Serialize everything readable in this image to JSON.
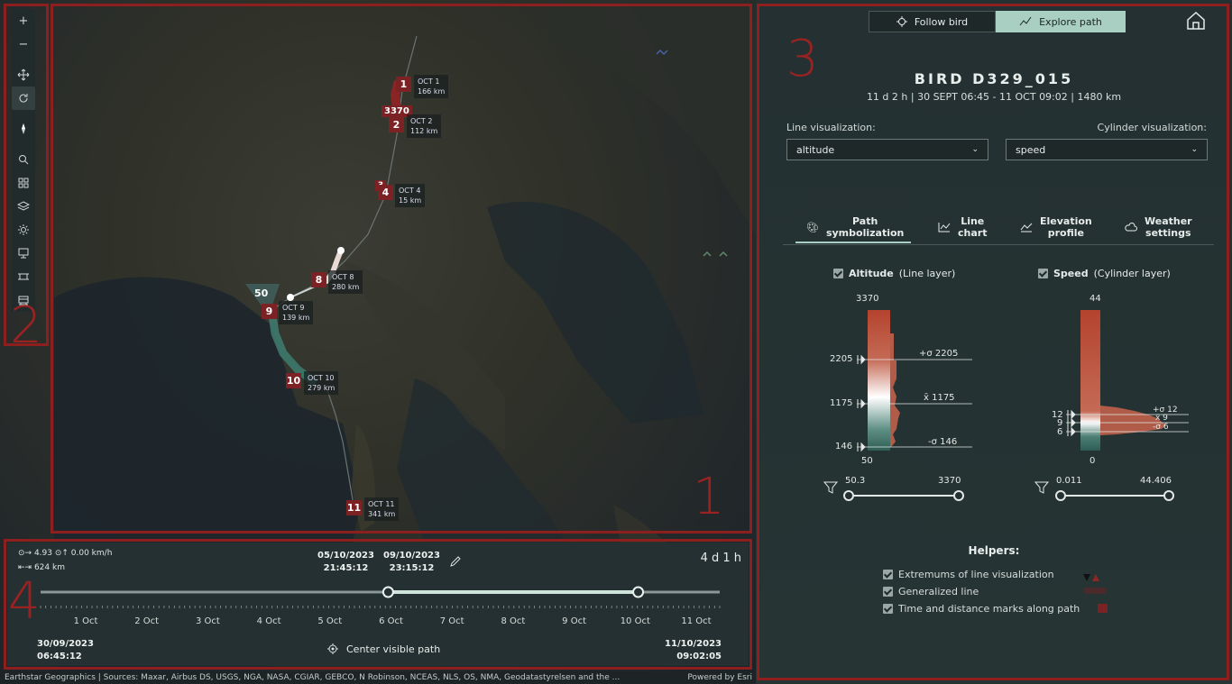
{
  "map": {
    "markers": [
      {
        "num": "1",
        "date": "OCT 1",
        "dist": "166 km"
      },
      {
        "num": "2",
        "date": "OCT 2",
        "dist": "112 km"
      },
      {
        "num": "4",
        "date": "OCT 4",
        "dist": "15 km"
      },
      {
        "num": "8",
        "date": "OCT 8",
        "dist": "280 km"
      },
      {
        "num": "9",
        "date": "OCT 9",
        "dist": "139 km"
      },
      {
        "num": "10",
        "date": "OCT 10",
        "dist": "279 km"
      },
      {
        "num": "11",
        "date": "OCT 11",
        "dist": "341 km"
      }
    ],
    "max_altitude_flag": "3370",
    "max_speed_flag": "50",
    "small_flag": "3"
  },
  "regions": [
    "1",
    "2",
    "3",
    "4"
  ],
  "toolbar": {
    "zoom_in": "+",
    "zoom_out": "−",
    "icons": [
      "pan-icon",
      "rotate-icon",
      "compass-icon",
      "search-icon",
      "basemap-gallery-icon",
      "layers-icon",
      "daylight-icon",
      "slides-icon",
      "elevation-icon",
      "train-icon"
    ]
  },
  "timeline": {
    "stats_line1": "⊙→ 4.93 ⊙↑ 0.00 km/h",
    "stats_line2": "⇤⇥ 624 km",
    "range_start_date": "05/10/2023",
    "range_start_time": "21:45:12",
    "range_end_date": "09/10/2023",
    "range_end_time": "23:15:12",
    "duration": "4 d 1 h",
    "ticks": [
      "1 Oct",
      "2 Oct",
      "3 Oct",
      "4 Oct",
      "5 Oct",
      "6 Oct",
      "7 Oct",
      "8 Oct",
      "9 Oct",
      "10 Oct",
      "11 Oct"
    ],
    "start_date": "30/09/2023",
    "start_time": "06:45:12",
    "end_date": "11/10/2023",
    "end_time": "09:02:05",
    "center_label": "Center visible path",
    "range_start_fraction": 0.5118,
    "range_end_fraction": 0.8799
  },
  "attribution": {
    "text": "Earthstar Geographics | Sources: Maxar, Airbus DS, USGS, NGA, NASA, CGIAR, GEBCO, N Robinson, NCEAS, NLS, OS, NMA, Geodatastyrelsen and the ...",
    "powered": "Powered by Esri"
  },
  "panel": {
    "follow_label": "Follow bird",
    "explore_label": "Explore path",
    "bird_title": "BIRD D329_015",
    "summary": "11 d 2 h | 30 SEPT 06:45 - 11 OCT 09:02 | 1480 km",
    "line_vis_label": "Line visualization:",
    "cyl_vis_label": "Cylinder visualization:",
    "line_vis_value": "altitude",
    "cyl_vis_value": "speed",
    "tabs": [
      {
        "l1": "Path",
        "l2": "symbolization"
      },
      {
        "l1": "Line",
        "l2": "chart"
      },
      {
        "l1": "Elevation",
        "l2": "profile"
      },
      {
        "l1": "Weather",
        "l2": "settings"
      }
    ],
    "altitude": {
      "label": "Altitude",
      "sub": "(Line layer)",
      "max": "3370",
      "min": "50",
      "upper": "2205",
      "mean": "1175",
      "lower": "146",
      "upper_lbl": "+σ 2205",
      "mean_lbl": "x̄ 1175",
      "lower_lbl": "-σ 146",
      "filter_min": "50.3",
      "filter_max": "3370"
    },
    "speed": {
      "label": "Speed",
      "sub": "(Cylinder layer)",
      "max": "44",
      "min": "0",
      "upper": "12",
      "mean": "9",
      "lower": "6",
      "upper_lbl": "+σ 12",
      "mean_lbl": "x̄ 9",
      "lower_lbl": "-σ 6",
      "filter_min": "0.011",
      "filter_max": "44.406"
    },
    "helpers_title": "Helpers:",
    "helpers": [
      "Extremums of line visualization",
      "Generalized line",
      "Time and distance marks along path"
    ],
    "colors": {
      "accent": "#a8cfc1",
      "marker": "#7d2224",
      "annotation": "#9b2222"
    }
  }
}
